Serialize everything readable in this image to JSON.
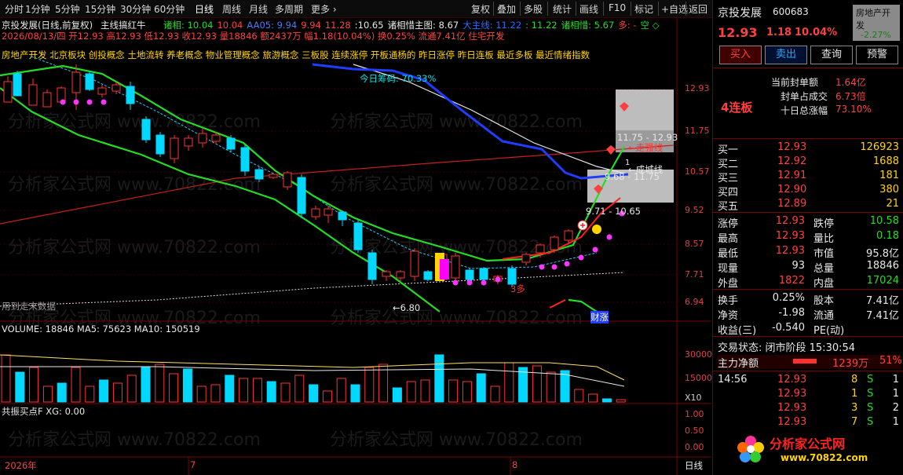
{
  "toolbar": {
    "items": [
      "分时",
      "1分钟",
      "5分钟",
      "15分钟",
      "30分钟",
      "60分钟",
      "日线",
      "周线",
      "月线",
      "多周期",
      "更多 ›"
    ],
    "right_items": [
      "复权",
      "叠加",
      "多股",
      "统计",
      "画线",
      "F10",
      "标记",
      "+自选",
      "返回"
    ]
  },
  "chart": {
    "title": "京投发展(日线,前复权)",
    "indicator_name": "主线搞红牛",
    "ind_values": [
      {
        "text": "诸相: 10.04",
        "color": "#22dd22"
      },
      {
        "text": "10.04",
        "color": "#ff4040"
      },
      {
        "text": "AA05: 9.94",
        "color": "#4a7bff"
      },
      {
        "text": "9.94",
        "color": "#ff4040"
      },
      {
        "text": "11.28",
        "color": "#ff4040"
      },
      {
        "text": ":10.65",
        "color": "#e8e8e8"
      },
      {
        "text": "诸相惜主图: 8.67",
        "color": "#e8e8e8"
      },
      {
        "text": "大主线: 11.22",
        "color": "#2a6cff"
      },
      {
        "text": ": 11.22",
        "color": "#22dd22"
      },
      {
        "text": "诸相惜: 5.67",
        "color": "#22dd22"
      },
      {
        "text": "多: -",
        "color": "#ff4040"
      },
      {
        "text": "空 ◇",
        "color": "#22dd22"
      }
    ],
    "ohlc_line": "2026/08/13/四 开12.93 高12.93 低12.93 收12.93 量18846 额2437万 幅1.18(10.04%) 换0.25% 流通7.41亿 住宅开发",
    "concept_line": "房地产开发 北京板块 创投概念 土地流转 养老概念 物业管理概念 旅游概念 三板股 连续涨停 开板通杨的 昨日涨停 昨日连板 最近多板 最近情绪指数",
    "today_profit": "今日筹码: 70.33%",
    "note_left_bottom": "用到走末数据",
    "annotations": {
      "range_top": "11.75 - 12.93",
      "range_bottom": "9.68 - 11.75",
      "walk_strong": "←走强线",
      "cost_line": "←成城线",
      "low_mark": "←6.80",
      "price_pair": "9.71 - 10.65",
      "duo": "3多",
      "cai": "财涨",
      "one": "1"
    },
    "price_labels": [
      "12.93",
      "11.75",
      "10.57",
      "9.52",
      "8.57",
      "7.71",
      "6.94"
    ],
    "volume": {
      "header": "VOLUME: 18846  MA5: 75623  MA10: 150519",
      "labels": [
        "30000",
        "15000",
        "X10"
      ]
    },
    "sub": {
      "header": "共振买点F  XG: 0.00",
      "labels": [
        "1.00",
        "0.50",
        "0.00"
      ]
    },
    "date_axis": [
      "2026年",
      "7",
      "8"
    ],
    "period_label": "日线",
    "watermark": "分析家公式网 www.70822.com"
  },
  "panel": {
    "stock_name": "京投发展",
    "stock_code": "600683",
    "sector_tag": "房地产开发",
    "sector_change": "-2.27%",
    "price": "12.93",
    "change": "1.18",
    "change_pct": "10.04%",
    "buttons": [
      "买入",
      "卖出",
      "查询",
      "预警"
    ],
    "seal": [
      {
        "label": "当前封单额",
        "value": "1.64亿"
      },
      {
        "label": "封单占成交",
        "value": "6.73倍"
      },
      {
        "label": "十日总涨幅",
        "value": "73.10%"
      }
    ],
    "board_tag": "4连板",
    "bids": [
      {
        "label": "买一",
        "price": "12.93",
        "vol": "126923"
      },
      {
        "label": "买二",
        "price": "12.92",
        "vol": "1688"
      },
      {
        "label": "买三",
        "price": "12.91",
        "vol": "181"
      },
      {
        "label": "买四",
        "price": "12.90",
        "vol": "380"
      },
      {
        "label": "买五",
        "price": "12.89",
        "vol": "21"
      }
    ],
    "stats": [
      {
        "l1": "涨停",
        "v1": "12.93",
        "c1": "red",
        "l2": "跌停",
        "v2": "10.58",
        "c2": "green"
      },
      {
        "l1": "最高",
        "v1": "12.93",
        "c1": "red",
        "l2": "量比",
        "v2": "0.18",
        "c2": "green"
      },
      {
        "l1": "最低",
        "v1": "12.93",
        "c1": "red",
        "l2": "市值",
        "v2": "95.8亿",
        "c2": "white"
      },
      {
        "l1": "现量",
        "v1": "93",
        "c1": "white",
        "l2": "总量",
        "v2": "18846",
        "c2": "white"
      },
      {
        "l1": "外盘",
        "v1": "1822",
        "c1": "red",
        "l2": "内盘",
        "v2": "17024",
        "c2": "green"
      }
    ],
    "stats2": [
      {
        "l1": "换手",
        "v1": "0.25%",
        "c1": "white",
        "l2": "股本",
        "v2": "7.41亿",
        "c2": "white"
      },
      {
        "l1": "净资",
        "v1": "-1.98",
        "c1": "white",
        "l2": "流通",
        "v2": "7.41亿",
        "c2": "white"
      },
      {
        "l1": "收益(三)",
        "v1": "-0.540",
        "c1": "white",
        "l2": "PE(动)",
        "v2": "",
        "c2": "white"
      }
    ],
    "trade_status": "交易状态: 闭市阶段 15:30:54",
    "main_net": {
      "label": "主力净额",
      "value": "1239万",
      "pct": "51%"
    },
    "ticks": [
      {
        "time": "14:56",
        "price": "12.93",
        "vol": "8",
        "side": "S",
        "n": "1"
      },
      {
        "time": "",
        "price": "12.93",
        "vol": "1",
        "side": "S",
        "n": "1"
      },
      {
        "time": "",
        "price": "12.93",
        "vol": "3",
        "side": "S",
        "n": "2"
      },
      {
        "time": "",
        "price": "12.93",
        "vol": "7",
        "side": "S",
        "n": "1"
      }
    ],
    "logo_title": "分析家公式网",
    "logo_url": "www.70822.com"
  },
  "colors": {
    "up": "#ff3333",
    "down": "#00d8ff",
    "ma_green": "#22dd22",
    "blue": "#1f3cff",
    "bg": "#000000"
  }
}
